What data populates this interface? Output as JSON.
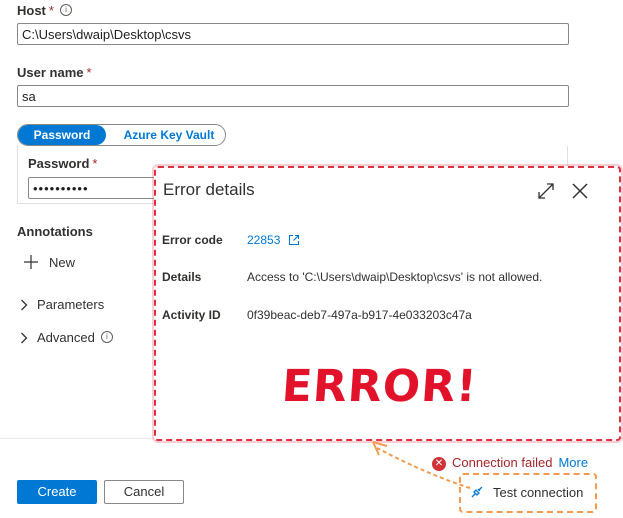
{
  "form": {
    "host_label": "Host",
    "host_required": "*",
    "host_value": "C:\\Users\\dwaip\\Desktop\\csvs",
    "username_label": "User name",
    "username_required": "*",
    "username_value": "sa",
    "auth_tabs": [
      "Password",
      "Azure Key Vault"
    ],
    "password_label": "Password",
    "password_required": "*",
    "password_value": "••••••••••",
    "annotations_label": "Annotations",
    "new_label": "New",
    "parameters_label": "Parameters",
    "advanced_label": "Advanced"
  },
  "error_panel": {
    "title": "Error details",
    "error_code_label": "Error code",
    "error_code_value": "22853",
    "details_label": "Details",
    "details_value": "Access to 'C:\\Users\\dwaip\\Desktop\\csvs' is not allowed.",
    "activity_id_label": "Activity ID",
    "activity_id_value": "0f39beac-deb7-497a-b917-4e033203c47a",
    "annotation_text": "ERROR!"
  },
  "footer": {
    "status_text": "Connection failed",
    "more_link": "More",
    "test_connection_label": "Test connection",
    "create_label": "Create",
    "cancel_label": "Cancel"
  },
  "colors": {
    "accent": "#0078d4",
    "error": "#a4262c",
    "annotation_red": "#e3122b",
    "annotation_orange": "#f39a4f"
  },
  "icons": [
    "info-icon",
    "plus-icon",
    "chevron-right-icon",
    "expand-icon",
    "close-icon",
    "external-link-icon",
    "error-circle-icon",
    "plug-icon"
  ]
}
